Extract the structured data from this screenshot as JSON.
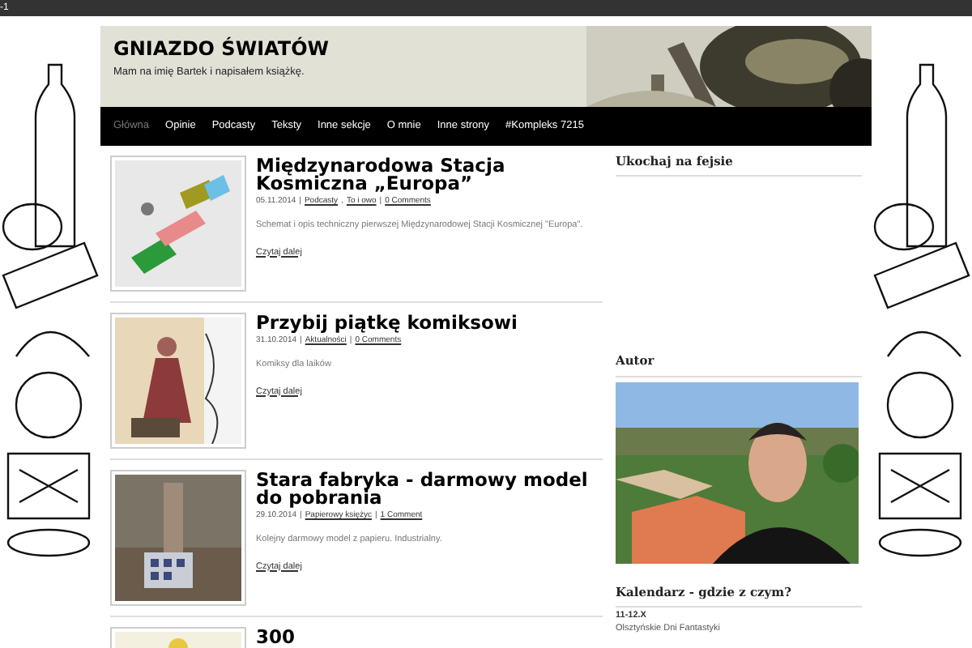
{
  "top_bar": {
    "text": "-1"
  },
  "site": {
    "title": "GNIAZDO ŚWIATÓW",
    "tagline": "Mam na imię Bartek i napisałem książkę."
  },
  "nav": {
    "items": [
      {
        "label": "Główna",
        "selected": true
      },
      {
        "label": "Opinie",
        "selected": false
      },
      {
        "label": "Podcasty",
        "selected": false
      },
      {
        "label": "Teksty",
        "selected": false
      },
      {
        "label": "Inne sekcje",
        "selected": false
      },
      {
        "label": "O mnie",
        "selected": false
      },
      {
        "label": "Inne strony",
        "selected": false
      },
      {
        "label": "#Kompleks 7215",
        "selected": false
      }
    ]
  },
  "posts": [
    {
      "title": "Międzynarodowa Stacja Kosmiczna „Europa”",
      "meta": [
        {
          "kind": "text",
          "text": "05.11.2014"
        },
        {
          "kind": "text",
          "text": "|"
        },
        {
          "kind": "link",
          "text": "Podcasty"
        },
        {
          "kind": "text",
          "text": ","
        },
        {
          "kind": "link",
          "text": "To i owo"
        },
        {
          "kind": "text",
          "text": "|"
        },
        {
          "kind": "link",
          "text": "0 Comments"
        }
      ],
      "excerpt": "Schemat i opis techniczny pierwszej Międzynarodowej Stacji Kosmicznej \"Europa\".",
      "read_more": "Czytaj dalej"
    },
    {
      "title": "Przybij piątkę komiksowi",
      "meta": [
        {
          "kind": "text",
          "text": "31.10.2014"
        },
        {
          "kind": "text",
          "text": "|"
        },
        {
          "kind": "link",
          "text": "Aktualności"
        },
        {
          "kind": "text",
          "text": "|"
        },
        {
          "kind": "link",
          "text": "0 Comments"
        }
      ],
      "excerpt": "Komiksy dla laików",
      "read_more": "Czytaj dalej"
    },
    {
      "title": "Stara fabryka - darmowy model do pobrania",
      "meta": [
        {
          "kind": "text",
          "text": "29.10.2014"
        },
        {
          "kind": "text",
          "text": "|"
        },
        {
          "kind": "link",
          "text": "Papierowy księżyc"
        },
        {
          "kind": "text",
          "text": "|"
        },
        {
          "kind": "link",
          "text": "1 Comment"
        }
      ],
      "excerpt": "Kolejny darmowy model z papieru. Industrialny.",
      "read_more": "Czytaj dalej"
    },
    {
      "title": "300"
    }
  ],
  "sidebar": {
    "widgets": [
      {
        "kind": "facebook",
        "title": "Ukochaj na fejsie"
      },
      {
        "kind": "author",
        "title": "Autor"
      },
      {
        "kind": "calendar",
        "title": "Kalendarz - gdzie z czym?",
        "entries": [
          {
            "date": "11-12.X",
            "name": "Olsztyńskie Dni Fantastyki"
          }
        ]
      }
    ]
  }
}
